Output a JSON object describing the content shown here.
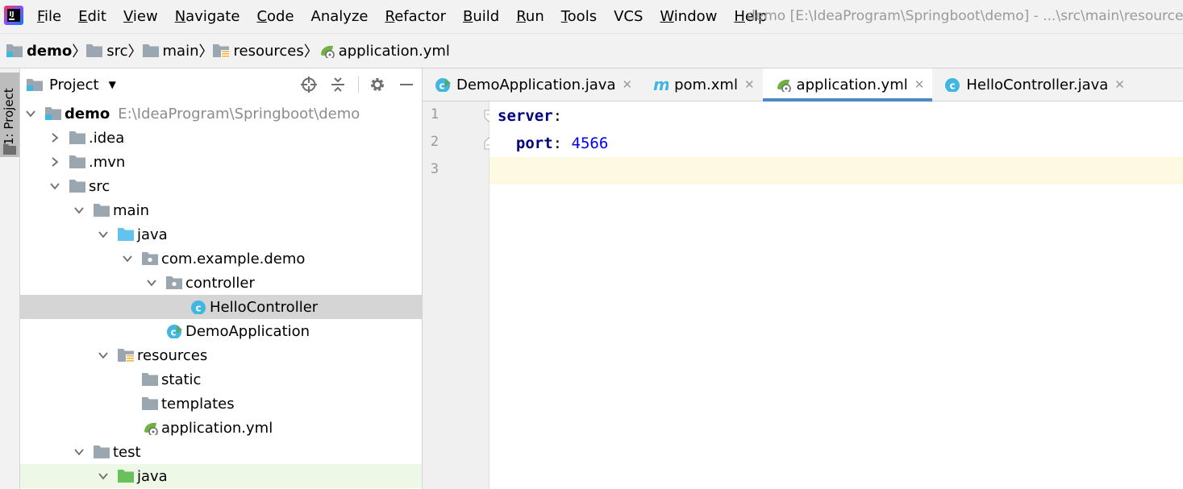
{
  "menubar": {
    "items": [
      {
        "label": "File",
        "mnemonic": "F",
        "rest": "ile"
      },
      {
        "label": "Edit",
        "mnemonic": "E",
        "rest": "dit"
      },
      {
        "label": "View",
        "mnemonic": "V",
        "rest": "iew"
      },
      {
        "label": "Navigate",
        "mnemonic": "N",
        "rest": "avigate"
      },
      {
        "label": "Code",
        "mnemonic": "C",
        "rest": "ode"
      },
      {
        "label": "Analyze",
        "mnemonic": "",
        "rest": "Analyze"
      },
      {
        "label": "Refactor",
        "mnemonic": "R",
        "rest": "efactor"
      },
      {
        "label": "Build",
        "mnemonic": "B",
        "rest": "uild"
      },
      {
        "label": "Run",
        "mnemonic": "R",
        "rest": "un"
      },
      {
        "label": "Tools",
        "mnemonic": "T",
        "rest": "ools"
      },
      {
        "label": "VCS",
        "mnemonic": "",
        "rest": "VCS"
      },
      {
        "label": "Window",
        "mnemonic": "W",
        "rest": "indow"
      },
      {
        "label": "Help",
        "mnemonic": "H",
        "rest": "elp"
      }
    ],
    "window_title": "demo [E:\\IdeaProgram\\Springboot\\demo] - ...\\src\\main\\resources"
  },
  "breadcrumb": [
    {
      "label": "demo",
      "icon": "module-folder-icon"
    },
    {
      "label": "src",
      "icon": "folder-icon"
    },
    {
      "label": "main",
      "icon": "folder-icon"
    },
    {
      "label": "resources",
      "icon": "resources-folder-icon"
    },
    {
      "label": "application.yml",
      "icon": "spring-yml-icon"
    }
  ],
  "sidebar": {
    "tool_window_label": "1: Project"
  },
  "project_panel": {
    "title": "Project",
    "tree": [
      {
        "label": "demo",
        "path": "E:\\IdeaProgram\\Springboot\\demo",
        "depth": 0,
        "arrow": "down",
        "icon": "module-folder-icon",
        "bold": true
      },
      {
        "label": ".idea",
        "depth": 1,
        "arrow": "right",
        "icon": "folder-icon"
      },
      {
        "label": ".mvn",
        "depth": 1,
        "arrow": "right",
        "icon": "folder-icon"
      },
      {
        "label": "src",
        "depth": 1,
        "arrow": "down",
        "icon": "folder-icon"
      },
      {
        "label": "main",
        "depth": 2,
        "arrow": "down",
        "icon": "folder-icon"
      },
      {
        "label": "java",
        "depth": 3,
        "arrow": "down",
        "icon": "source-folder-icon"
      },
      {
        "label": "com.example.demo",
        "depth": 4,
        "arrow": "down",
        "icon": "package-icon"
      },
      {
        "label": "controller",
        "depth": 5,
        "arrow": "down",
        "icon": "package-icon"
      },
      {
        "label": "HelloController",
        "depth": 6,
        "arrow": "none",
        "icon": "class-icon",
        "selected": true
      },
      {
        "label": "DemoApplication",
        "depth": 5,
        "arrow": "none",
        "icon": "spring-class-icon"
      },
      {
        "label": "resources",
        "depth": 3,
        "arrow": "down",
        "icon": "resources-folder-icon"
      },
      {
        "label": "static",
        "depth": 4,
        "arrow": "none",
        "icon": "folder-icon"
      },
      {
        "label": "templates",
        "depth": 4,
        "arrow": "none",
        "icon": "folder-icon"
      },
      {
        "label": "application.yml",
        "depth": 4,
        "arrow": "none",
        "icon": "spring-yml-icon"
      },
      {
        "label": "test",
        "depth": 2,
        "arrow": "down",
        "icon": "folder-icon"
      },
      {
        "label": "java",
        "depth": 3,
        "arrow": "down",
        "icon": "test-folder-icon",
        "test": true
      }
    ]
  },
  "editor": {
    "tabs": [
      {
        "label": "DemoApplication.java",
        "icon": "spring-class-icon",
        "active": false
      },
      {
        "label": "pom.xml",
        "icon": "maven-icon",
        "active": false
      },
      {
        "label": "application.yml",
        "icon": "spring-yml-icon",
        "active": true
      },
      {
        "label": "HelloController.java",
        "icon": "class-icon",
        "active": false
      }
    ],
    "line_numbers": [
      "1",
      "2",
      "3"
    ],
    "lines": [
      {
        "key": "server",
        "sep": ":",
        "value": "",
        "indent": ""
      },
      {
        "key": "port",
        "sep": ": ",
        "value": "4566",
        "indent": "  "
      },
      {
        "key": "",
        "sep": "",
        "value": "",
        "indent": ""
      }
    ]
  }
}
